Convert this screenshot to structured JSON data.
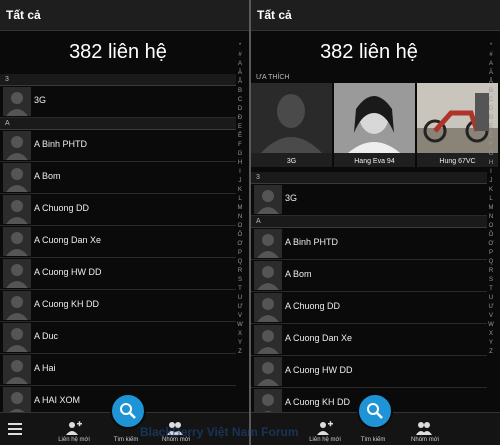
{
  "left": {
    "header_title": "Tất cả",
    "contact_count": "382 liên hệ",
    "sections": [
      {
        "letter": "3",
        "contacts": [
          "3G"
        ]
      },
      {
        "letter": "A",
        "contacts": [
          "A Binh PHTD",
          "A Bom",
          "A Chuong DD",
          "A Cuong Dan Xe",
          "A Cuong HW DD",
          "A Cuong KH DD",
          "A Duc",
          "A Hai",
          "A HAI XOM"
        ]
      }
    ]
  },
  "right": {
    "header_title": "Tất cả",
    "contact_count": "382 liên hệ",
    "favorites_label": "ƯA THÍCH",
    "favorites": [
      "3G",
      "Hang Eva 94",
      "Hung 67VC"
    ],
    "sections": [
      {
        "letter": "3",
        "contacts": [
          "3G"
        ]
      },
      {
        "letter": "A",
        "contacts": [
          "A Binh PHTD",
          "A Bom",
          "A Chuong DD",
          "A Cuong Dan Xe",
          "A Cuong HW DD",
          "A Cuong KH DD"
        ]
      }
    ]
  },
  "alphabet": [
    "*",
    "#",
    "A",
    "Ă",
    "Â",
    "B",
    "C",
    "D",
    "Đ",
    "E",
    "Ê",
    "F",
    "G",
    "H",
    "I",
    "J",
    "K",
    "L",
    "M",
    "N",
    "O",
    "Ô",
    "Ơ",
    "P",
    "Q",
    "R",
    "S",
    "T",
    "U",
    "Ư",
    "V",
    "W",
    "X",
    "Y",
    "Z"
  ],
  "actions": {
    "new_contact": "Liên hệ mới",
    "search": "Tìm kiếm",
    "new_group": "Nhóm mới"
  },
  "watermark": "BlackBerry Việt Nam Forum",
  "colors": {
    "accent": "#1e93d6",
    "background": "#0a0a0a"
  },
  "icons": [
    "person-silhouette-icon",
    "search-icon",
    "add-contact-icon",
    "add-group-icon",
    "menu-icon"
  ]
}
